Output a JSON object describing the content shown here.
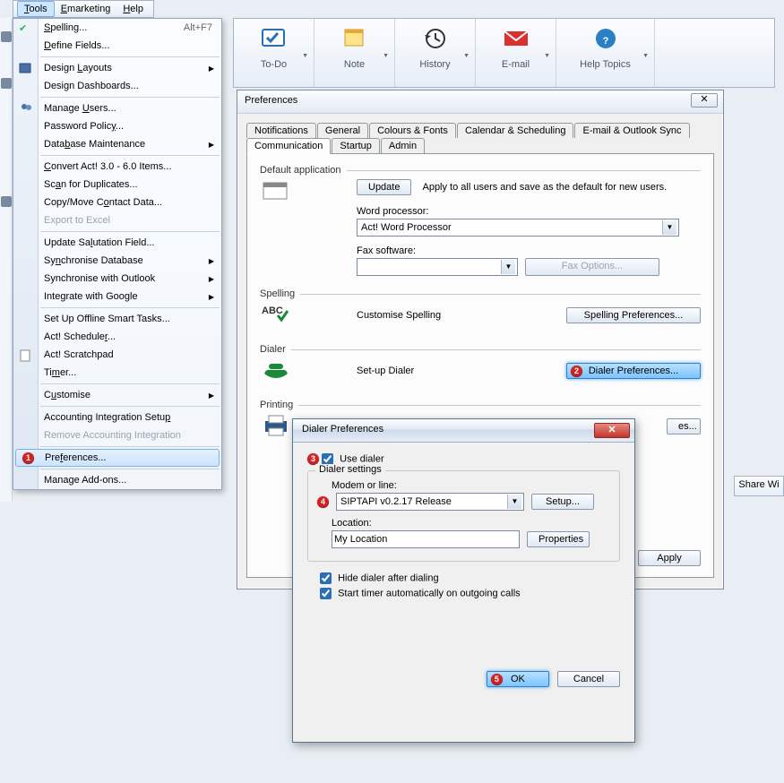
{
  "menubar": {
    "tools": "Tools",
    "emarketing": "Emarketing",
    "help": "Help"
  },
  "toolsMenu": {
    "spelling": "Spelling...",
    "spelling_hk": "Alt+F7",
    "defineFields": "Define Fields...",
    "designLayouts": "Design Layouts",
    "designDashboards": "Design Dashboards...",
    "manageUsers": "Manage Users...",
    "passwordPolicy": "Password Policy...",
    "databaseMaintenance": "Database Maintenance",
    "convertAct": "Convert Act! 3.0 - 6.0 Items...",
    "scanDuplicates": "Scan for Duplicates...",
    "copyMoveContact": "Copy/Move Contact Data...",
    "exportExcel": "Export to Excel",
    "updateSalutation": "Update Salutation Field...",
    "syncDatabase": "Synchronise Database",
    "syncOutlook": "Synchronise with Outlook",
    "integrateGoogle": "Integrate with Google",
    "setUpSmartTasks": "Set Up Offline Smart Tasks...",
    "actScheduler": "Act! Scheduler...",
    "actScratchpad": "Act! Scratchpad",
    "timer": "Timer...",
    "customise": "Customise",
    "accountingSetup": "Accounting Integration Setup",
    "removeAccounting": "Remove Accounting Integration",
    "preferences": "Preferences...",
    "manageAddons": "Manage Add-ons..."
  },
  "toolbar": {
    "todo": "To-Do",
    "note": "Note",
    "history": "History",
    "email": "E-mail",
    "helpTopics": "Help Topics"
  },
  "pref": {
    "title": "Preferences",
    "tabsTop": [
      "Notifications",
      "General",
      "Colours & Fonts",
      "Calendar & Scheduling",
      "E-mail & Outlook Sync"
    ],
    "tabsBot": [
      "Communication",
      "Startup",
      "Admin"
    ],
    "section_default": "Default application",
    "update": "Update",
    "apply_text": "Apply to all users and save as the default for new users.",
    "wp_label": "Word processor:",
    "wp_value": "Act! Word Processor",
    "fax_label": "Fax software:",
    "fax_options": "Fax Options...",
    "section_spelling": "Spelling",
    "custom_spelling": "Customise Spelling",
    "spelling_prefs": "Spelling Preferences...",
    "section_dialer": "Dialer",
    "setup_dialer": "Set-up Dialer",
    "dialer_prefs": "Dialer Preferences...",
    "section_printing": "Printing",
    "es_btn": "es...",
    "apply_btn": "Apply"
  },
  "dlg": {
    "title": "Dialer Preferences",
    "use_dialer": "Use dialer",
    "grp_title": "Dialer settings",
    "modem_lbl": "Modem or line:",
    "modem_val": "SIPTAPI v0.2.17 Release",
    "setup": "Setup...",
    "loc_lbl": "Location:",
    "loc_val": "My Location",
    "properties": "Properties",
    "hide": "Hide dialer after dialing",
    "starttimer": "Start timer automatically on outgoing calls",
    "ok": "OK",
    "cancel": "Cancel"
  },
  "shareBtn": "Share Wi",
  "badges": {
    "b1": "1",
    "b2": "2",
    "b3": "3",
    "b4": "4",
    "b5": "5"
  }
}
